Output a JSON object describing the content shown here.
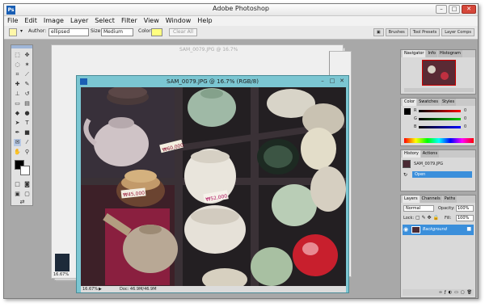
{
  "app": {
    "title": "Adobe Photoshop"
  },
  "menu": [
    "File",
    "Edit",
    "Image",
    "Layer",
    "Select",
    "Filter",
    "View",
    "Window",
    "Help"
  ],
  "options": {
    "author_label": "Author:",
    "author_value": "ellipsed",
    "size_label": "Size:",
    "size_value": "Medium",
    "color_label": "Color:",
    "clear_all": "Clear All",
    "palette_tabs": [
      "Brushes",
      "Tool Presets",
      "Layer Comps"
    ]
  },
  "document": {
    "title": "SAM_0079.JPG @ 16.7% (RGB/8)",
    "zoom": "16.67%",
    "doc_size": "Doc: 46.9M/46.9M",
    "background_title": "SAM_0079.JPG @ 16.7%",
    "background_zoom": "16.67%"
  },
  "price_tags": [
    "₩60,000",
    "₩45,000",
    "₩52,000"
  ],
  "panels": {
    "navigator": {
      "tabs": [
        "Navigator",
        "Info",
        "Histogram"
      ]
    },
    "color": {
      "tabs": [
        "Color",
        "Swatches",
        "Styles"
      ],
      "channels": [
        "R",
        "G",
        "B"
      ],
      "values": [
        "0",
        "0",
        "0"
      ]
    },
    "history": {
      "tabs": [
        "History",
        "Actions"
      ],
      "snapshot": "SAM_0079.JPG",
      "state": "Open"
    },
    "layers": {
      "tabs": [
        "Layers",
        "Channels",
        "Paths"
      ],
      "mode": "Normal",
      "opacity_label": "Opacity:",
      "opacity": "100%",
      "lock_label": "Lock:",
      "fill_label": "Fill:",
      "fill": "100%",
      "layer_name": "Background"
    }
  },
  "colors": {
    "accent": "#3b8fdb",
    "doc_frame": "#7bc6d2",
    "foreground": "#000000",
    "background": "#ffffff",
    "note_color": "#ffff80"
  }
}
